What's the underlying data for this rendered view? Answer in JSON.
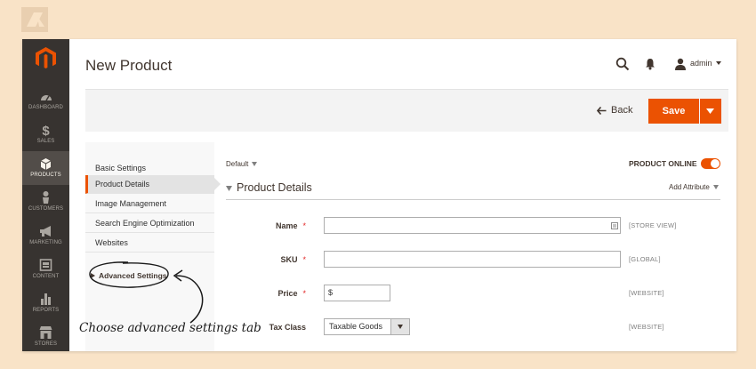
{
  "colors": {
    "accent": "#eb5202",
    "nav_bg": "#373330",
    "nav_active": "#524d49",
    "background": "#f9e3c7"
  },
  "nav": {
    "items": [
      {
        "label": "DASHBOARD",
        "icon": "dashboard-icon"
      },
      {
        "label": "SALES",
        "icon": "dollar-icon"
      },
      {
        "label": "PRODUCTS",
        "icon": "cube-icon",
        "active": true
      },
      {
        "label": "CUSTOMERS",
        "icon": "person-icon"
      },
      {
        "label": "MARKETING",
        "icon": "megaphone-icon"
      },
      {
        "label": "CONTENT",
        "icon": "content-icon"
      },
      {
        "label": "REPORTS",
        "icon": "bar-chart-icon"
      },
      {
        "label": "STORES",
        "icon": "store-icon"
      }
    ]
  },
  "header": {
    "title": "New Product",
    "user": "admin"
  },
  "actions": {
    "back": "Back",
    "save": "Save"
  },
  "side": {
    "heading": "Basic Settings",
    "tabs": [
      {
        "label": "Product Details",
        "active": true
      },
      {
        "label": "Image Management"
      },
      {
        "label": "Search Engine Optimization"
      },
      {
        "label": "Websites"
      }
    ],
    "advanced": "Advanced Settings"
  },
  "main": {
    "scope": "Default",
    "product_online": "PRODUCT ONLINE",
    "section_title": "Product Details",
    "add_attribute": "Add Attribute",
    "fields": [
      {
        "label": "Name",
        "required": "*",
        "value": "",
        "scope": "[STORE VIEW]"
      },
      {
        "label": "SKU",
        "required": "*",
        "value": "",
        "scope": "[GLOBAL]"
      },
      {
        "label": "Price",
        "required": "*",
        "value": "$",
        "scope": "[WEBSITE]"
      },
      {
        "label": "Tax Class",
        "value": "Taxable Goods",
        "scope": "[WEBSITE]"
      }
    ]
  },
  "annotation": "Choose advanced settings tab"
}
